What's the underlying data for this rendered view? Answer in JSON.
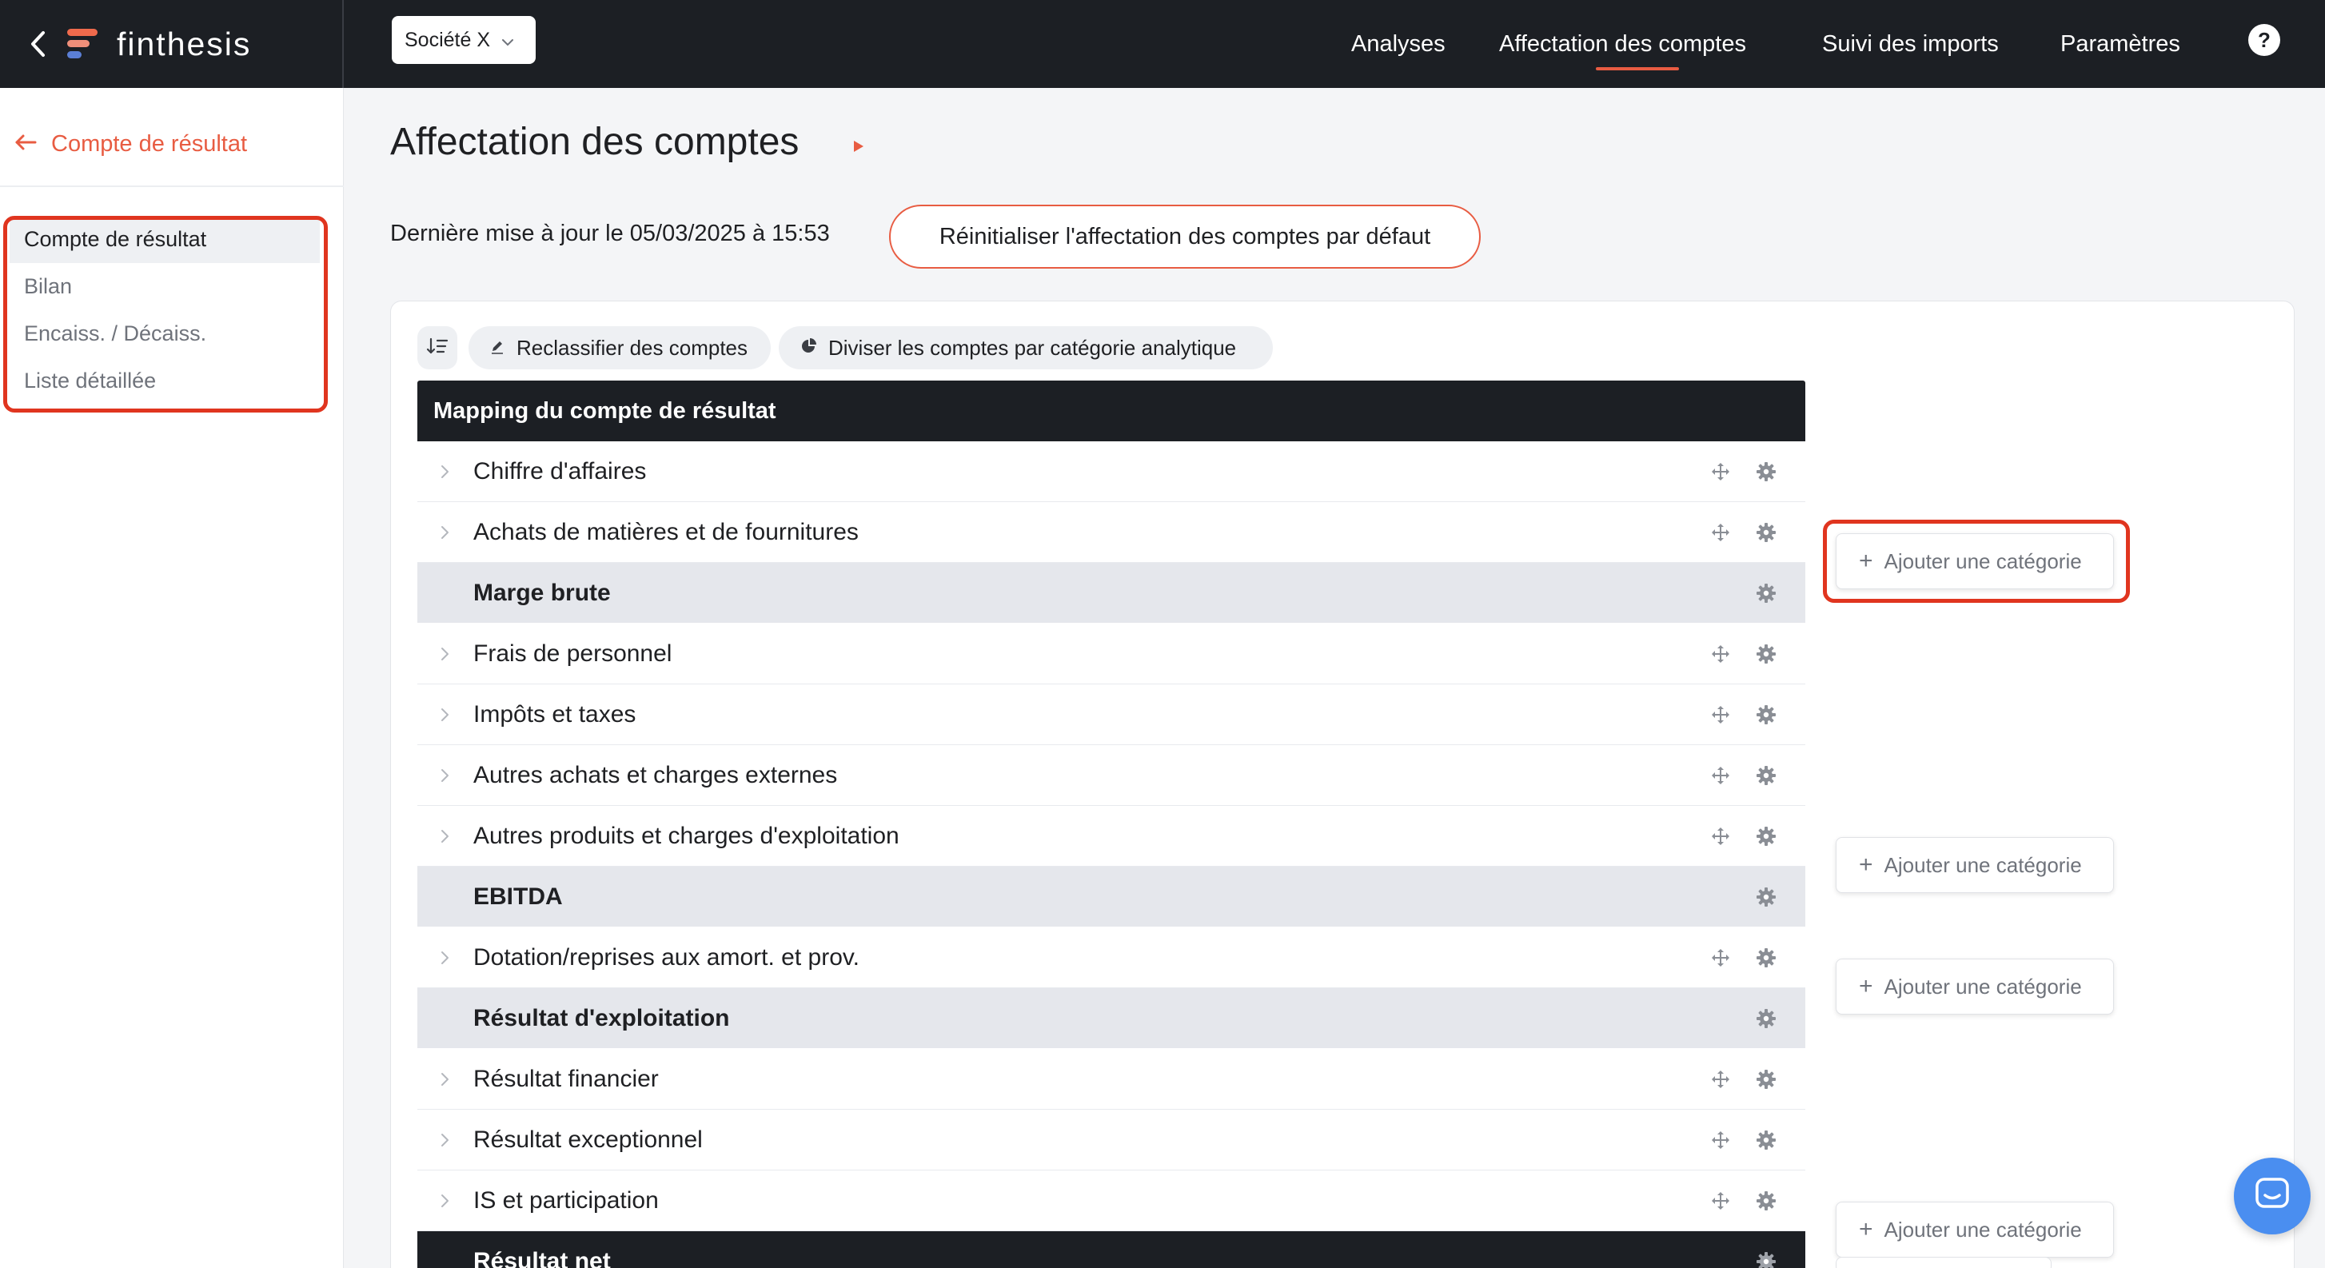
{
  "app": {
    "brand_name": "finthesis",
    "company_selector": "Société X",
    "nav": [
      {
        "label": "Analyses",
        "active": false
      },
      {
        "label": "Affectation des comptes",
        "active": true
      },
      {
        "label": "Suivi des imports",
        "active": false
      },
      {
        "label": "Paramètres",
        "active": false
      }
    ],
    "help_label": "?"
  },
  "sidebar": {
    "back_label": "Compte de résultat",
    "items": [
      {
        "label": "Compte de résultat",
        "active": true
      },
      {
        "label": "Bilan",
        "active": false
      },
      {
        "label": "Encaiss. / Décaiss.",
        "active": false
      },
      {
        "label": "Liste détaillée",
        "active": false
      }
    ]
  },
  "main": {
    "title": "Affectation des comptes",
    "last_update": "Dernière mise à jour le 05/03/2025 à 15:53",
    "reset_button": "Réinitialiser l'affectation des comptes par défaut",
    "toolbar": {
      "reclassify": "Reclassifier des comptes",
      "split": "Diviser les comptes par catégorie analytique"
    },
    "table": {
      "header": "Mapping du compte de résultat",
      "rows": [
        {
          "label": "Chiffre d'affaires",
          "type": "category"
        },
        {
          "label": "Achats de matières et de fournitures",
          "type": "category"
        },
        {
          "label": "Marge brute",
          "type": "subtotal"
        },
        {
          "label": "Frais de personnel",
          "type": "category"
        },
        {
          "label": "Impôts et taxes",
          "type": "category"
        },
        {
          "label": "Autres achats et charges externes",
          "type": "category"
        },
        {
          "label": "Autres produits et charges d'exploitation",
          "type": "category"
        },
        {
          "label": "EBITDA",
          "type": "subtotal"
        },
        {
          "label": "Dotation/reprises aux amort. et prov.",
          "type": "category"
        },
        {
          "label": "Résultat d'exploitation",
          "type": "subtotal"
        },
        {
          "label": "Résultat financier",
          "type": "category"
        },
        {
          "label": "Résultat exceptionnel",
          "type": "category"
        },
        {
          "label": "IS et participation",
          "type": "category"
        },
        {
          "label": "Résultat net",
          "type": "total"
        }
      ]
    },
    "add_category_label": "Ajouter une catégorie"
  },
  "colors": {
    "accent": "#e85c42",
    "highlight": "#e0351f",
    "dark": "#1c1f24",
    "subtotal_bg": "#e5e7ec",
    "chat": "#4a8ef0"
  },
  "icons": [
    "back-chevron-icon",
    "finthesis-logo-icon",
    "chevron-down-icon",
    "help-icon",
    "arrow-left-icon",
    "play-icon",
    "sort-icon",
    "pencil-icon",
    "pie-chart-icon",
    "chevron-right-icon",
    "move-icon",
    "gear-icon",
    "plus-icon",
    "chat-icon"
  ]
}
